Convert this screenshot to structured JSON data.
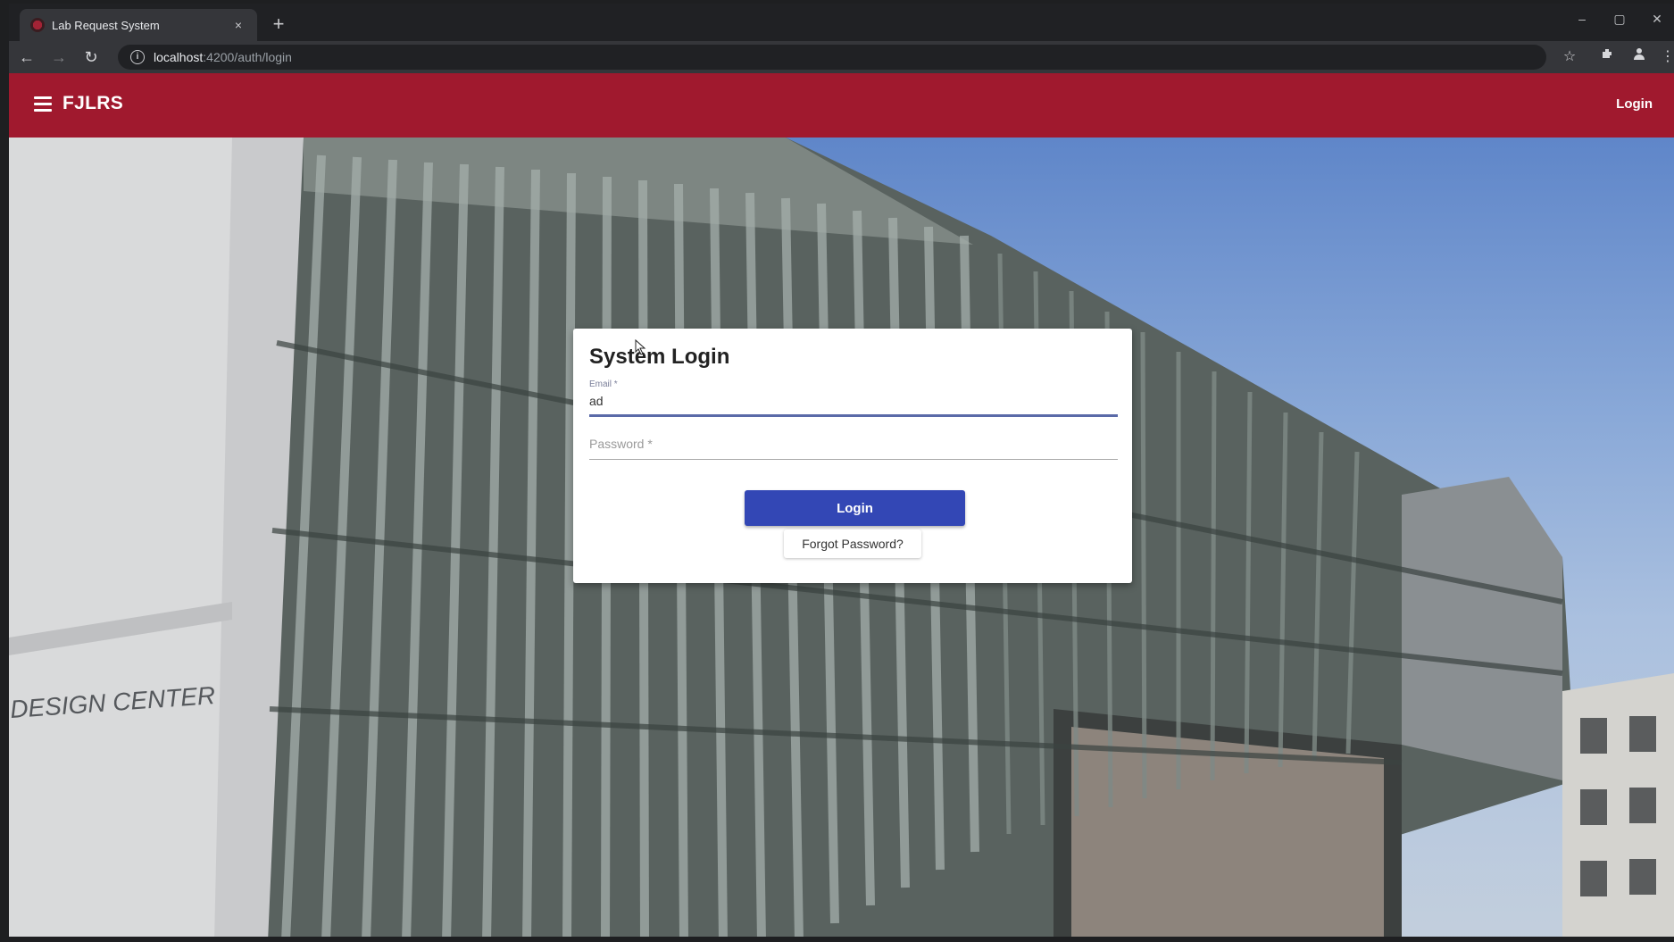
{
  "browser": {
    "tab_title": "Lab Request System",
    "tab_close": "×",
    "new_tab": "+",
    "url_host": "localhost",
    "url_path": ":4200/auth/login",
    "window_controls": {
      "minimize": "–",
      "maximize": "▢",
      "close": "✕"
    }
  },
  "header": {
    "brand": "FJLRS",
    "login_label": "Login",
    "color": "#a0192e"
  },
  "login_card": {
    "title": "System Login",
    "email_label": "Email *",
    "email_value": "ad",
    "password_placeholder": "Password *",
    "login_button": "Login",
    "forgot_button": "Forgot Password?",
    "button_color": "#3347b5"
  },
  "background": {
    "building_sign": "DESIGN CENTER"
  }
}
